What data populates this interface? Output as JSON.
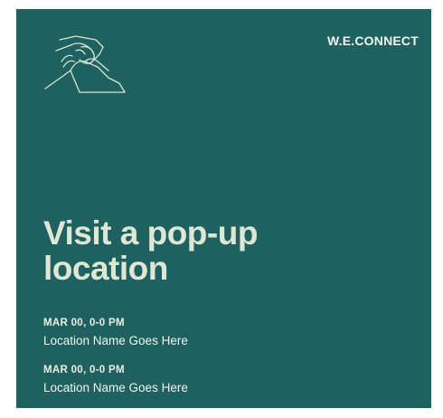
{
  "brand": {
    "name": "W.E.CONNECT",
    "tagline": "· · · · · · · · · · · · ·"
  },
  "headline": {
    "line1": "Visit a pop-up",
    "line2": "location"
  },
  "faint_text": "· · · · · · · · · · · · · · · ·",
  "events": [
    {
      "date": "MAR 00, 0-0 PM",
      "location": "Location Name Goes Here"
    },
    {
      "date": "MAR 00, 0-0 PM",
      "location": "Location Name Goes Here"
    }
  ],
  "colors": {
    "background": "#1f6160",
    "text": "#e7ecdc",
    "outline": "#d9e4d2"
  },
  "icons": {
    "logo": "handshake-icon"
  }
}
